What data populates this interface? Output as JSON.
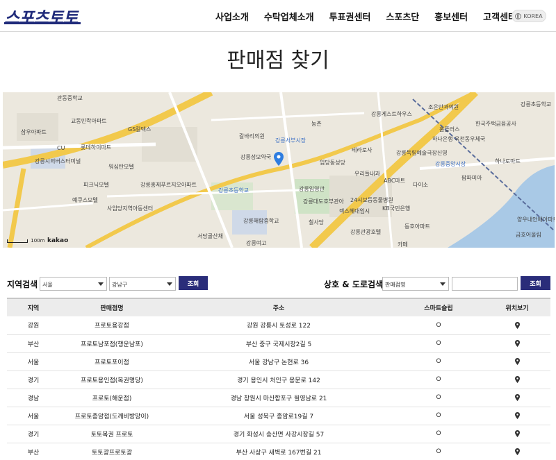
{
  "header": {
    "logo": "스포츠토토",
    "nav": [
      "사업소개",
      "수탁업체소개",
      "투표권센터",
      "스포츠단",
      "홍보센터",
      "고객센터"
    ],
    "lang": "KOREA"
  },
  "page": {
    "title": "판매점 찾기"
  },
  "map": {
    "labels": [
      "관동중학교",
      "교동민락아파트",
      "GS칼텍스",
      "갈바리의원",
      "강릉서부시장",
      "강릉게스트하우스",
      "조은안과의원",
      "강릉초등학교",
      "삼우아파트",
      "롯데하이마트",
      "강릉시외버스터미널",
      "워심탄모텔",
      "피크닉모텔",
      "강릉홍제푸르지오아파트",
      "강릉성모약국",
      "임당동성당",
      "테라로사",
      "강릉독립예술극장신영",
      "홈플러스",
      "한국주택금융공사",
      "하나은행",
      "옥천동우체국",
      "예쿠스모텔",
      "사임당지역아동센터",
      "강릉초등학교",
      "강릉임영관",
      "강릉대도호부관아",
      "24시보듬동물병원",
      "ABC마트",
      "다이소",
      "팜파미아",
      "하나로마트",
      "우리들내과",
      "KB국민은행",
      "강릉해람중학교",
      "칠사당",
      "렉스헤대입시",
      "강릉관광호텔",
      "동호아파트",
      "서당골산채",
      "강릉중앙시장",
      "강릉여고",
      "카페",
      "양우내안애아파트",
      "금호어울림",
      "CU",
      "농촌"
    ],
    "scale": "100m",
    "brand": "kakao"
  },
  "search": {
    "region_label": "지역검색",
    "region_city": "서울",
    "region_district": "강남구",
    "region_button": "조회",
    "name_label": "상호 & 도로검색",
    "name_type": "판매점명",
    "name_query": "",
    "name_button": "조회"
  },
  "table": {
    "columns": [
      "지역",
      "판매점명",
      "주소",
      "스마트슬립",
      "위치보기"
    ],
    "rows": [
      [
        "강원",
        "프로토용강점",
        "강원 강릉시 토성로 122",
        "O"
      ],
      [
        "부산",
        "프로토남포점(행운남포)",
        "부산 중구 국제시장2길 5",
        "O"
      ],
      [
        "서울",
        "프로토포이점",
        "서울 강남구 논현로 36",
        "O"
      ],
      [
        "경기",
        "프로토용인점(복권명당)",
        "경기 용인시 처인구 용문로 142",
        "O"
      ],
      [
        "경남",
        "프로토(해운점)",
        "경남 창원시 마산합포구 월영남로 21",
        "O"
      ],
      [
        "서울",
        "프로토종암점(도깨비방망이)",
        "서울 성북구 종암로19길 7",
        "O"
      ],
      [
        "경기",
        "토토복권 프로토",
        "경기 화성시 송산면 사강시장길 57",
        "O"
      ],
      [
        "부산",
        "토토광프로토광",
        "부산 사상구 새벽로 167번길 21",
        "O"
      ]
    ]
  }
}
